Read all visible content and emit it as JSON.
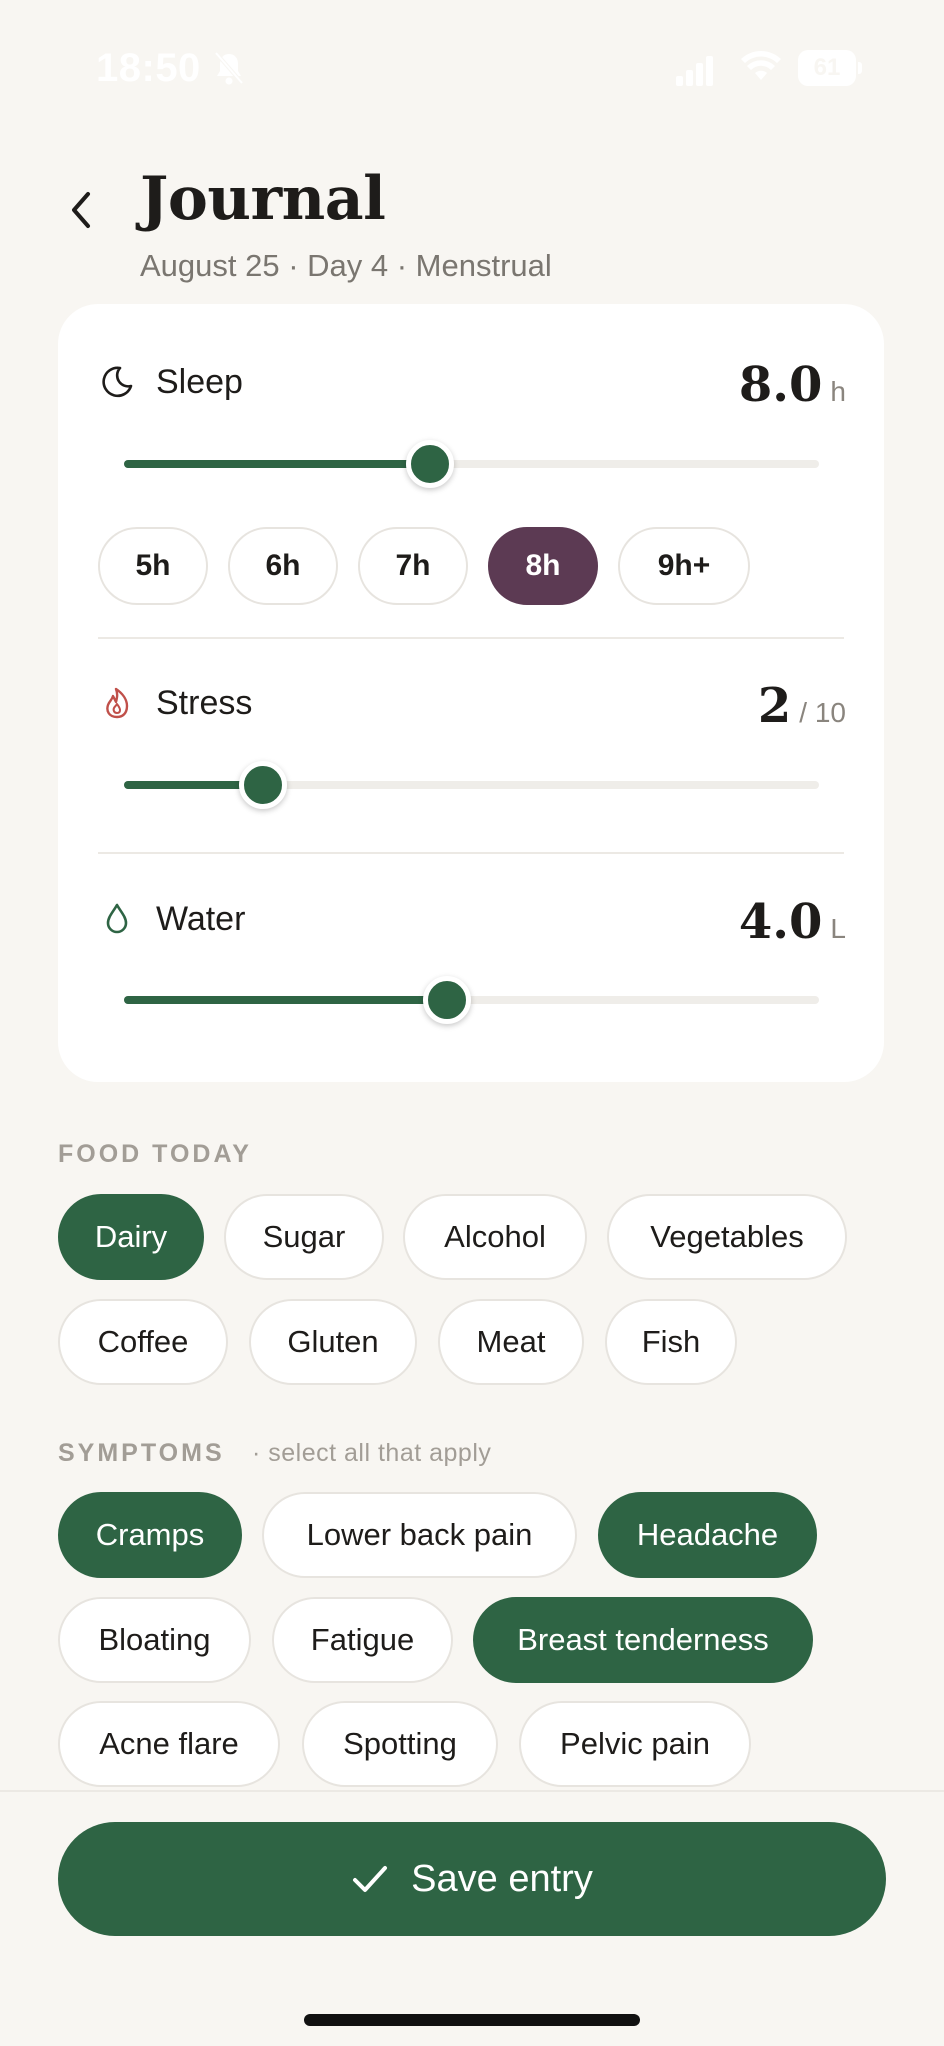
{
  "status_bar": {
    "time": "18:50",
    "battery": "61"
  },
  "header": {
    "title": "Journal",
    "subtitle": "August 25 · Day 4 · Menstrual"
  },
  "metrics": {
    "sleep": {
      "label": "Sleep",
      "value": "8.0",
      "unit": "h",
      "slider_fraction": 0.44,
      "quick_options": [
        {
          "label": "5h",
          "selected": false
        },
        {
          "label": "6h",
          "selected": false
        },
        {
          "label": "7h",
          "selected": false
        },
        {
          "label": "8h",
          "selected": true
        },
        {
          "label": "9h+",
          "selected": false
        }
      ]
    },
    "stress": {
      "label": "Stress",
      "value": "2",
      "unit": "/ 10",
      "slider_fraction": 0.2
    },
    "water": {
      "label": "Water",
      "value": "4.0",
      "unit": "L",
      "slider_fraction": 0.465
    }
  },
  "food": {
    "heading": "FOOD TODAY",
    "items": [
      {
        "label": "Dairy",
        "selected": true
      },
      {
        "label": "Sugar",
        "selected": false
      },
      {
        "label": "Alcohol",
        "selected": false
      },
      {
        "label": "Vegetables",
        "selected": false
      },
      {
        "label": "Coffee",
        "selected": false
      },
      {
        "label": "Gluten",
        "selected": false
      },
      {
        "label": "Meat",
        "selected": false
      },
      {
        "label": "Fish",
        "selected": false
      }
    ]
  },
  "symptoms": {
    "heading": "SYMPTOMS",
    "hint": "· select all that apply",
    "items": [
      {
        "label": "Cramps",
        "selected": true
      },
      {
        "label": "Lower back pain",
        "selected": false
      },
      {
        "label": "Headache",
        "selected": true
      },
      {
        "label": "Bloating",
        "selected": false
      },
      {
        "label": "Fatigue",
        "selected": false
      },
      {
        "label": "Breast tenderness",
        "selected": true
      },
      {
        "label": "Acne flare",
        "selected": false
      },
      {
        "label": "Spotting",
        "selected": false
      },
      {
        "label": "Pelvic pain",
        "selected": false
      }
    ]
  },
  "save": {
    "label": "Save entry"
  },
  "colors": {
    "accent_green": "#2e6444",
    "accent_plum": "#5c3a53",
    "stress_red": "#c0504a",
    "background": "#f8f6f2"
  },
  "icons": {
    "sleep": "moon-icon",
    "stress": "flame-icon",
    "water": "droplet-icon",
    "back": "chevron-left-icon",
    "save": "check-icon"
  }
}
